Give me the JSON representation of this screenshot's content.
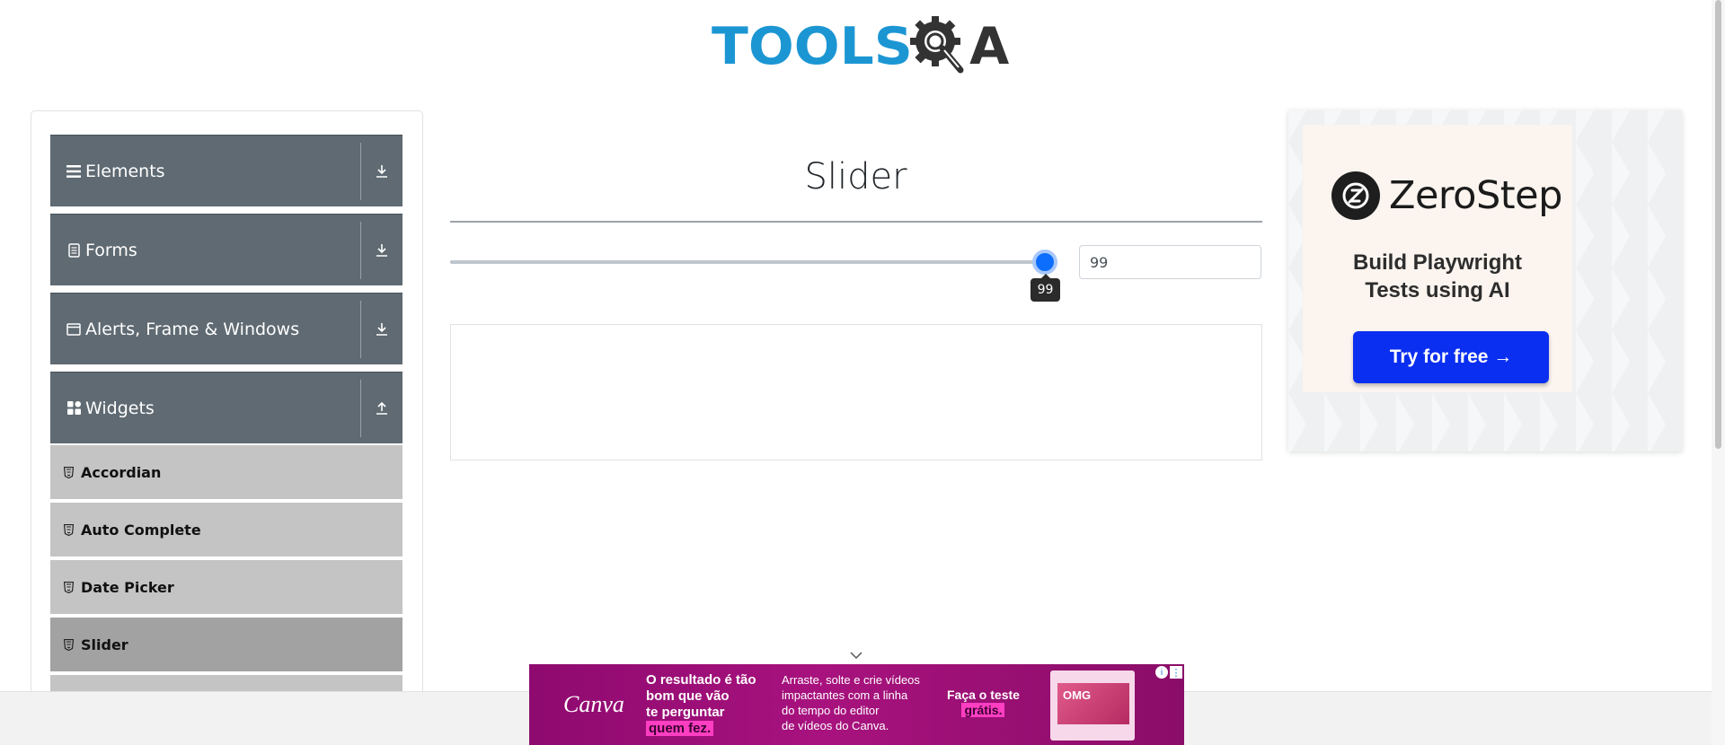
{
  "header": {
    "logo_text_left": "TOOLS",
    "logo_text_right": "A",
    "logo_color_primary": "#1c96d3",
    "logo_color_dark": "#333333"
  },
  "sidebar": {
    "groups": [
      {
        "title": "Elements",
        "icon": "hamburger-icon",
        "toggle_icon": "download-arrow-icon",
        "expanded": false
      },
      {
        "title": "Forms",
        "icon": "document-icon",
        "toggle_icon": "download-arrow-icon",
        "expanded": false
      },
      {
        "title": "Alerts, Frame & Windows",
        "icon": "window-icon",
        "toggle_icon": "download-arrow-icon",
        "expanded": false
      },
      {
        "title": "Widgets",
        "icon": "grid-icon",
        "toggle_icon": "upload-arrow-icon",
        "expanded": true
      }
    ],
    "widget_items": [
      {
        "label": "Accordian",
        "active": false
      },
      {
        "label": "Auto Complete",
        "active": false
      },
      {
        "label": "Date Picker",
        "active": false
      },
      {
        "label": "Slider",
        "active": true
      }
    ],
    "colors": {
      "group_bg": "#5f6a72",
      "item_bg": "#c4c4c4",
      "item_active_bg": "#a2a2a2"
    }
  },
  "main": {
    "title": "Slider",
    "slider": {
      "value": 99,
      "min": 0,
      "max": 100,
      "tooltip": "99",
      "color": "#0d6efd"
    },
    "value_field": "99"
  },
  "right_ad": {
    "brand": "ZeroStep",
    "headline_line1": "Build Playwright",
    "headline_line2": "Tests using AI",
    "cta": "Try for free →",
    "cta_color": "#0b2ff0"
  },
  "bottom_banner": {
    "brand": "Canva",
    "headline": [
      "O resultado é tão",
      "bom que vão",
      "te perguntar"
    ],
    "headline_highlight": "quem fez.",
    "body": [
      "Arraste, solte e crie vídeos",
      "impactantes com a linha",
      "do tempo do editor",
      "de vídeos do Canva."
    ],
    "cta_line1": "Faça o teste",
    "cta_highlight": "grátis.",
    "thumb_text": "OMG",
    "info_label": "i",
    "more_label": "⋮"
  }
}
